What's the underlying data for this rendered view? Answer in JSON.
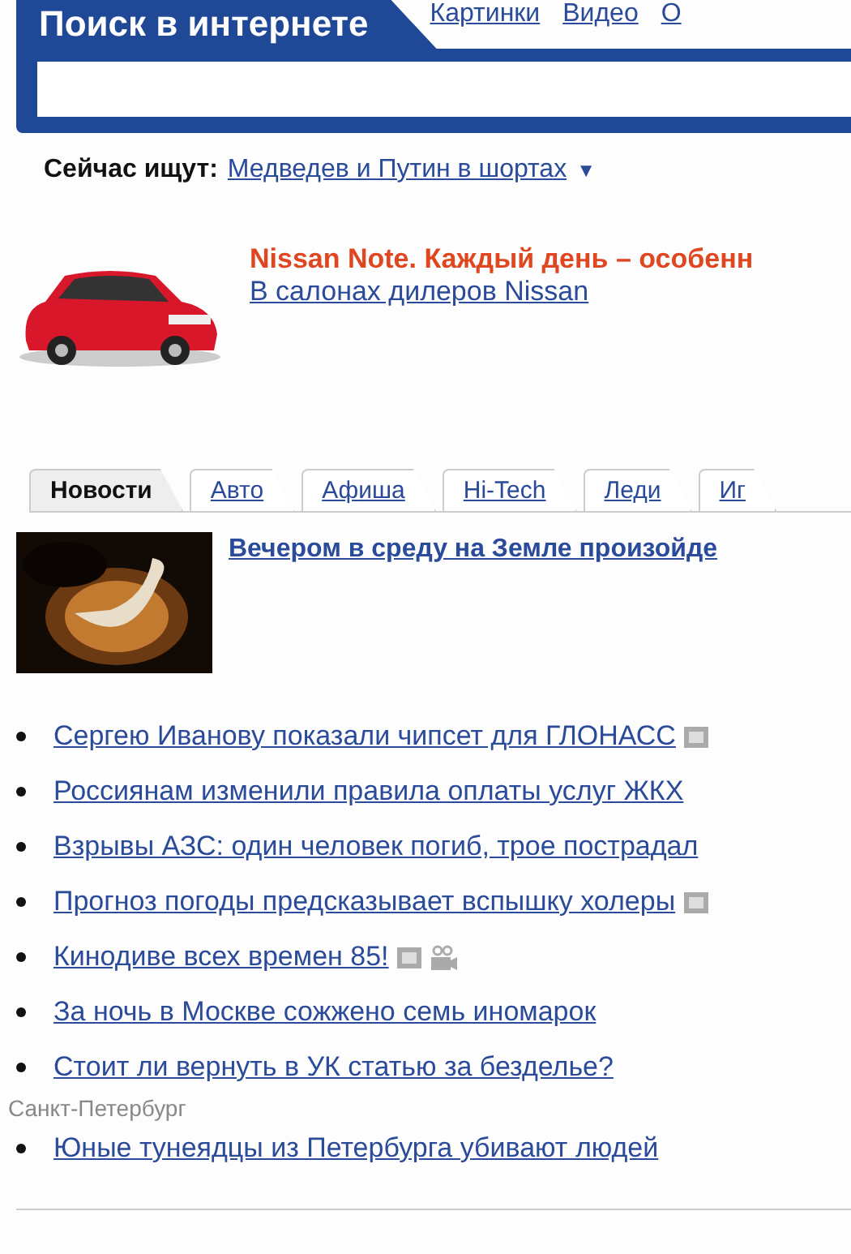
{
  "search": {
    "title": "Поиск в интернете",
    "links": [
      {
        "label": "Картинки"
      },
      {
        "label": "Видео"
      },
      {
        "label": "О"
      }
    ]
  },
  "trending": {
    "label": "Сейчас ищут:",
    "query": "Медведев и Путин в шортах",
    "toggle": "▼"
  },
  "ad": {
    "headline": "Nissan Note. Каждый день – особенн",
    "link": "В салонах дилеров Nissan"
  },
  "tabs": [
    {
      "label": "Новости",
      "selected": true
    },
    {
      "label": "Авто",
      "selected": false
    },
    {
      "label": "Афиша",
      "selected": false
    },
    {
      "label": "Hi-Tech",
      "selected": false
    },
    {
      "label": "Леди",
      "selected": false
    },
    {
      "label": "Иг",
      "selected": false
    }
  ],
  "feature": {
    "headline": "Вечером в среду на Земле произойде"
  },
  "news": [
    {
      "title": "Сергею Иванову показали чипсет для ГЛОНАСС",
      "photo": true,
      "video": false
    },
    {
      "title": "Россиянам изменили правила оплаты услуг ЖКХ",
      "photo": false,
      "video": false
    },
    {
      "title": "Взрывы АЗС: один человек погиб, трое пострадал",
      "photo": false,
      "video": false
    },
    {
      "title": "Прогноз погоды предсказывает вспышку холеры",
      "photo": true,
      "video": false
    },
    {
      "title": "Кинодиве всех времен 85!",
      "photo": true,
      "video": true
    },
    {
      "title": "За ночь в Москве сожжено семь иномарок",
      "photo": false,
      "video": false
    },
    {
      "title": "Стоит ли вернуть в УК статью за безделье?",
      "photo": false,
      "video": false
    }
  ],
  "regional": {
    "region": "Санкт-Петербург",
    "news": [
      {
        "title": "Юные тунеядцы из Петербурга убивают людей",
        "photo": false,
        "video": false
      }
    ]
  }
}
